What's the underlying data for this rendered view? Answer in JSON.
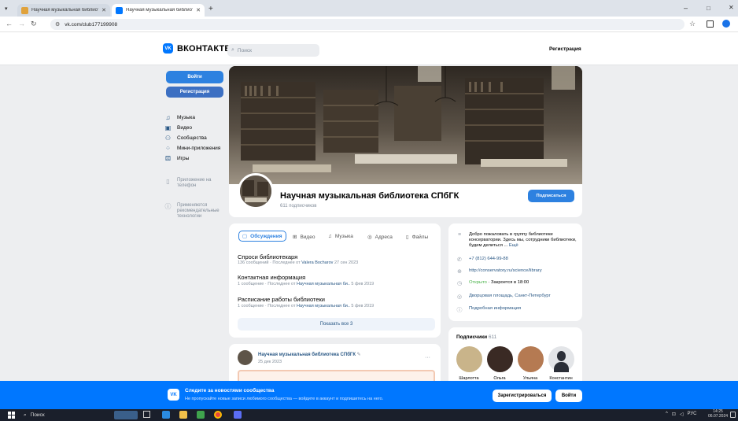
{
  "browser": {
    "tabs": [
      {
        "title": "Научная музыкальная библиот..."
      },
      {
        "title": "Научная музыкальная библиот..."
      }
    ],
    "url": "vk.com/club177199908"
  },
  "header": {
    "logo_text": "ВКОНТАКТЕ",
    "search_placeholder": "Поиск",
    "register": "Регистрация"
  },
  "sidebar": {
    "login": "Войти",
    "register": "Регистрация",
    "items": [
      {
        "label": "Музыка",
        "icon": "music-icon"
      },
      {
        "label": "Видео",
        "icon": "video-icon"
      },
      {
        "label": "Сообщества",
        "icon": "communities-icon"
      },
      {
        "label": "Мини-приложения",
        "icon": "apps-icon"
      },
      {
        "label": "Игры",
        "icon": "games-icon"
      }
    ],
    "phone_app": "Приложение на телефон",
    "recommend": "Применяются рекомендательные технологии"
  },
  "group": {
    "name": "Научная музыкальная библиотека СПбГК",
    "subscribers": "611 подписчиков",
    "subscribe_button": "Подписаться"
  },
  "discussion_tabs": [
    "Обсуждения",
    "Видео",
    "Музыка",
    "Адреса",
    "Файлы"
  ],
  "discussions": [
    {
      "title": "Спроси библиотекаря",
      "meta": "136 сообщений · Последнее от ",
      "author": "Valera Bocharov",
      "date": " 27 сен 2023"
    },
    {
      "title": "Контактная информация",
      "meta": "1 сообщение · Последнее от ",
      "author": "Научная музыкальная би..",
      "date": " 5 фев 2019"
    },
    {
      "title": "Расписание работы библиотеки",
      "meta": "1 сообщение · Последнее от ",
      "author": "Научная музыкальная би..",
      "date": " 5 фев 2019"
    }
  ],
  "show_all": "Показать все 3",
  "info": {
    "description": "Добро пожаловать в группу библиотеки консерватории. Здесь мы, сотрудники библиотеки, будем делиться ...",
    "more": "Ещё",
    "phone": "+7 (812) 644-99-88",
    "site": "http://conservatory.ru/science/library",
    "open_status": "Открыто",
    "closes": " · Закроется в 18:00",
    "address": "Дворцовая площадь, Санкт-Петербург",
    "details": "Подробная информация"
  },
  "post": {
    "author": "Научная музыкальная библиотека СПбГК",
    "date": "25 дек 2023",
    "more": "···"
  },
  "subscribers_block": {
    "title": "Подписчики",
    "count": "611",
    "people": [
      {
        "name": "Шарлотта",
        "color": "#c9b48a"
      },
      {
        "name": "Ольга",
        "color": "#3a2a24"
      },
      {
        "name": "Ульяна",
        "color": "#b57a52"
      },
      {
        "name": "Константин",
        "color": "#e3e5e8"
      }
    ]
  },
  "banner": {
    "title": "Следите за новостями сообщества",
    "subtitle": "Не пропускайте новые записи любимого сообщества — войдите в аккаунт и подпишитесь на него.",
    "register": "Зарегистрироваться",
    "login": "Войти"
  },
  "taskbar": {
    "search": "Поиск",
    "lang": "РУС",
    "time": "14:25",
    "date": "06.07.2024"
  },
  "colors": {
    "vk_blue": "#0077ff",
    "button_blue": "#2d81e0",
    "link": "#2a5885"
  }
}
